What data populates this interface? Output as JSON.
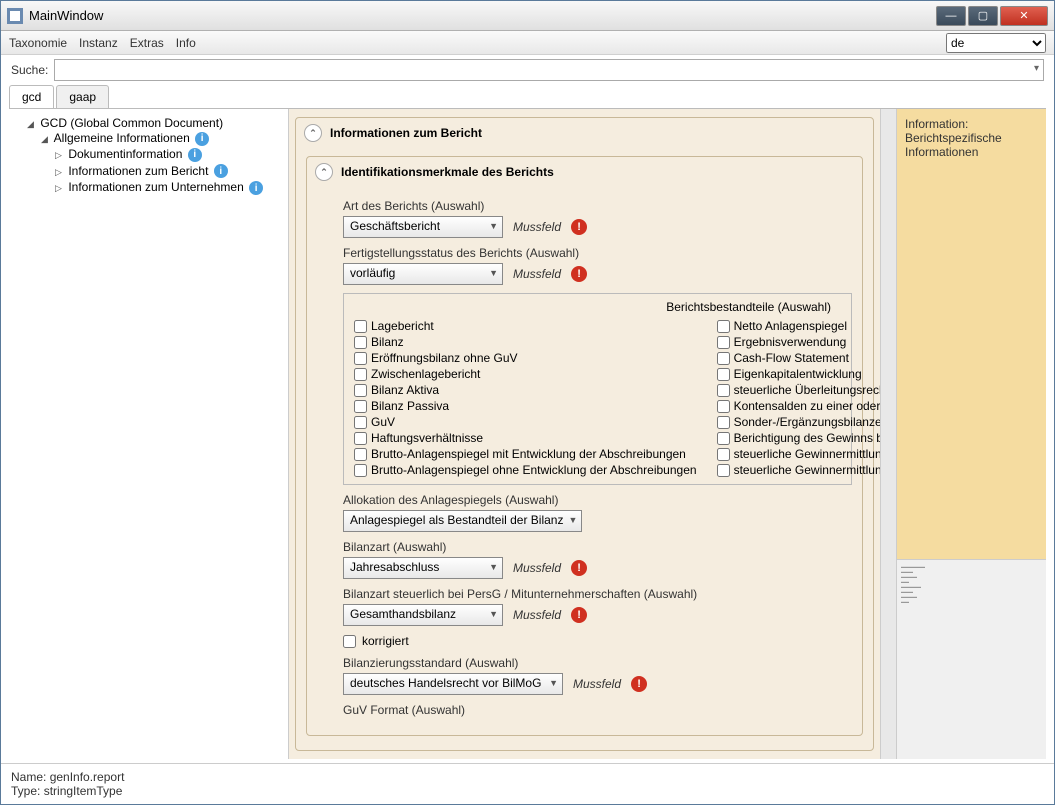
{
  "window": {
    "title": "MainWindow"
  },
  "menubar": {
    "items": [
      "Taxonomie",
      "Instanz",
      "Extras",
      "Info"
    ],
    "lang": "de"
  },
  "search": {
    "label": "Suche:"
  },
  "tabs": {
    "items": [
      "gcd",
      "gaap"
    ],
    "active": 0
  },
  "tree": {
    "root": "GCD (Global Common Document)",
    "child1": "Allgemeine Informationen",
    "leaves": [
      "Dokumentinformation",
      "Informationen zum Bericht",
      "Informationen zum Unternehmen"
    ]
  },
  "form": {
    "section1_title": "Informationen zum Bericht",
    "section2_title": "Identifikationsmerkmale des Berichts",
    "mussfeld": "Mussfeld",
    "fields": {
      "art": {
        "label": "Art des Berichts (Auswahl)",
        "value": "Geschäftsbericht"
      },
      "fertig": {
        "label": "Fertigstellungsstatus des Berichts (Auswahl)",
        "value": "vorläufig"
      },
      "allokation": {
        "label": "Allokation des Anlagespiegels (Auswahl)",
        "value": "Anlagespiegel als Bestandteil der Bilanz"
      },
      "bilanzart": {
        "label": "Bilanzart (Auswahl)",
        "value": "Jahresabschluss"
      },
      "bilanzart_steuer": {
        "label": "Bilanzart steuerlich bei PersG / Mitunternehmerschaften (Auswahl)",
        "value": "Gesamthandsbilanz"
      },
      "korrigiert": {
        "label": "korrigiert"
      },
      "standard": {
        "label": "Bilanzierungsstandard (Auswahl)",
        "value": "deutsches Handelsrecht vor BilMoG"
      },
      "guv": {
        "label": "GuV Format (Auswahl)"
      }
    },
    "checkgroup": {
      "title": "Berichtsbestandteile (Auswahl)",
      "col1": [
        "Lagebericht",
        "Bilanz",
        "Eröffnungsbilanz ohne GuV",
        "Zwischenlagebericht",
        "Bilanz Aktiva",
        "Bilanz Passiva",
        "GuV",
        "Haftungsverhältnisse",
        "Brutto-Anlagenspiegel mit Entwicklung der Abschreibungen",
        "Brutto-Anlagenspiegel ohne Entwicklung der Abschreibungen"
      ],
      "col2": [
        "Netto Anlagenspiegel",
        "Ergebnisverwendung",
        "Cash-Flow Statement",
        "Eigenkapitalentwicklung",
        "steuerliche Überleitungsrechnung",
        "Kontensalden zu einer oder mehre",
        "Sonder-/Ergänzungsbilanzen als Fr",
        "Berichtigung des Gewinns bei Wec",
        "steuerliche Gewinnermittlung",
        "steuerliche Gewinnermittlung bei P"
      ]
    }
  },
  "infopanel": {
    "title": "Information:",
    "text": "Berichtspezifische Informationen"
  },
  "status": {
    "name_label": "Name:",
    "name_value": "genInfo.report",
    "type_label": "Type:",
    "type_value": "stringItemType"
  }
}
